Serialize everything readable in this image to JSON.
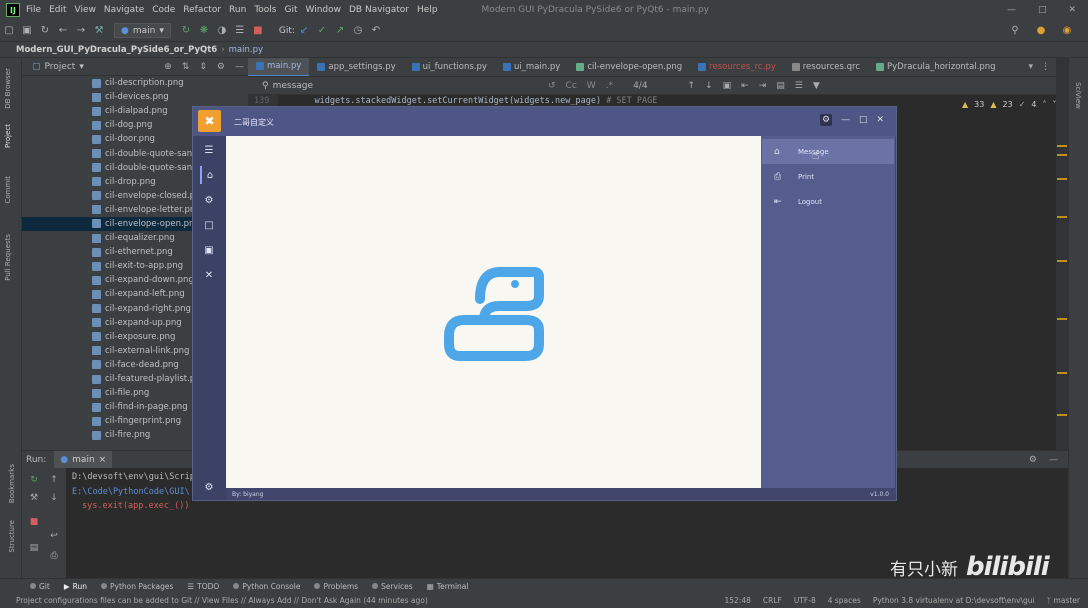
{
  "menubar": {
    "logo": "IJ",
    "items": [
      "File",
      "Edit",
      "View",
      "Navigate",
      "Code",
      "Refactor",
      "Run",
      "Tools",
      "Git",
      "Window",
      "DB Navigator",
      "Help"
    ],
    "window_title": "Modern GUI PyDracula PySide6 or PyQt6 - main.py"
  },
  "toolbar": {
    "run_config": "main",
    "git_label": "Git:"
  },
  "breadcrumb": {
    "project": "Modern_GUI_PyDracula_PySide6_or_PyQt6",
    "file": "main.py"
  },
  "left_strip": [
    "DB Browser",
    "Project",
    "Commit",
    "Pull Requests"
  ],
  "project_panel": {
    "title": "Project",
    "files": [
      "cil-description.png",
      "cil-devices.png",
      "cil-dialpad.png",
      "cil-dog.png",
      "cil-door.png",
      "cil-double-quote-sans-le",
      "cil-double-quote-sans-ri",
      "cil-drop.png",
      "cil-envelope-closed.png",
      "cil-envelope-letter.png",
      "cil-envelope-open.png",
      "cil-equalizer.png",
      "cil-ethernet.png",
      "cil-exit-to-app.png",
      "cil-expand-down.png",
      "cil-expand-left.png",
      "cil-expand-right.png",
      "cil-expand-up.png",
      "cil-exposure.png",
      "cil-external-link.png",
      "cil-face-dead.png",
      "cil-featured-playlist.png",
      "cil-file.png",
      "cil-find-in-page.png",
      "cil-fingerprint.png",
      "cil-fire.png"
    ],
    "selected_index": 10
  },
  "editor_tabs": [
    {
      "label": "main.py",
      "kind": "py",
      "active": true
    },
    {
      "label": "app_settings.py",
      "kind": "py"
    },
    {
      "label": "ui_functions.py",
      "kind": "py"
    },
    {
      "label": "ui_main.py",
      "kind": "py"
    },
    {
      "label": "cil-envelope-open.png",
      "kind": "img"
    },
    {
      "label": "resources_rc.py",
      "kind": "py",
      "modified": true
    },
    {
      "label": "resources.qrc",
      "kind": "qrc"
    },
    {
      "label": "PyDracula_horizontal.png",
      "kind": "img"
    }
  ],
  "find_bar": {
    "query": "message",
    "opt_case": "Cc",
    "opt_word": "W",
    "opt_regex": ".*",
    "count": "4/4"
  },
  "editor": {
    "line_no": "139",
    "code": "widgets.stackedWidget.setCurrentWidget(widgets.new_page)",
    "comment": "# SET PAGE",
    "warnings": "33",
    "weak_warnings": "23",
    "infos": "4"
  },
  "right_strip_label": "SciView",
  "run_panel": {
    "label": "Run:",
    "tab": "main",
    "lines": [
      {
        "text": "D:\\devsoft\\env\\gui\\Scripts\\python.exe",
        "color": "#bbbbbb"
      },
      {
        "text": "E:\\Code\\PythonCode\\GUI\\",
        "color": "#5c8fd6"
      },
      {
        "text": "sys.exit(app.exec_())",
        "color": "#d65d5d"
      }
    ],
    "side_labels": [
      "Bookmarks",
      "Structure"
    ]
  },
  "bottom_tabs": [
    "Git",
    "Run",
    "Python Packages",
    "TODO",
    "Python Console",
    "Problems",
    "Services",
    "Terminal"
  ],
  "status": {
    "message": "Project configurations files can be added to Git // View Files // Always Add // Don't Ask Again (44 minutes ago)",
    "position": "152:48",
    "line_sep": "CRLF",
    "encoding": "UTF-8",
    "indent": "4 spaces",
    "interpreter": "Python 3.8 virtualenv at D:\\devsoft\\env\\gui",
    "branch": "master"
  },
  "watermark": {
    "uploader": "有只小新",
    "site": "bilibili"
  },
  "app_window": {
    "title": "二哥自定义",
    "right_menu": [
      {
        "label": "Message",
        "icon": "home-icon",
        "active": true
      },
      {
        "label": "Print",
        "icon": "print-icon"
      },
      {
        "label": "Logout",
        "icon": "logout-icon"
      }
    ],
    "footer_left": "By: biyang",
    "footer_right": "v1.0.0",
    "accent": "#4da6e8"
  }
}
